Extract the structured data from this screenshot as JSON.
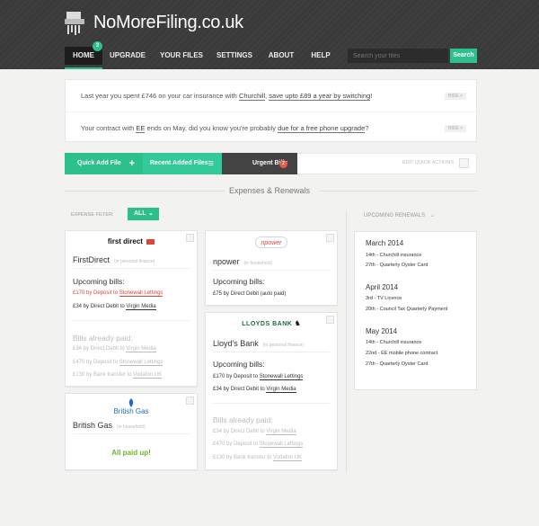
{
  "header": {
    "site_name": "NoMoreFiling.co.uk",
    "nav": [
      {
        "label": "HOME",
        "badge": "2"
      },
      {
        "label": "UPGRADE"
      },
      {
        "label": "YOUR FILES"
      },
      {
        "label": "SETTINGS"
      },
      {
        "label": "ABOUT"
      },
      {
        "label": "HELP"
      }
    ],
    "search_placeholder": "Search your files",
    "search_button": "Search"
  },
  "notices": [
    {
      "pre": "Last year you spent £746 on your car insurance with ",
      "link1": "Churchill",
      "mid": ", ",
      "link2": "save upto £89 a year by switching",
      "post": "!",
      "hide": "HIDE ×"
    },
    {
      "pre": "Your contract with ",
      "link1": "EE",
      "mid": " ends on May, did you know you're probably ",
      "link2": "due for a free phone upgrade",
      "post": "?",
      "hide": "HIDE ×"
    }
  ],
  "quick_actions": {
    "add_file": "Quick Add File",
    "recent": "Recent Added Files",
    "urgent": "Urgent Bills",
    "urgent_count": "2",
    "edit": "EDIT QUICK ACTIONS"
  },
  "section_title": "Expenses & Renewals",
  "filter": {
    "label": "EXPENSE FILTER:",
    "value": "ALL"
  },
  "cards": {
    "firstdirect": {
      "logo": "first direct",
      "name": "FirstDirect",
      "category": "(in personal finance)",
      "upcoming_title": "Upcoming bills:",
      "upcoming": [
        {
          "amount": "£170 by Deposit to ",
          "payee": "Stonewall Lettings"
        },
        {
          "amount": "£34 by Direct Debit to ",
          "payee": "Virgin Media"
        }
      ],
      "paid_title": "Bills already paid:",
      "paid": [
        {
          "amount": "£34 by Direct Debit to ",
          "payee": "Virgin Media"
        },
        {
          "amount": "£470 by Deposit to ",
          "payee": "Stonewall Lettings"
        },
        {
          "amount": "£130 by Bank transfer to ",
          "payee": "Vodafon UK"
        }
      ]
    },
    "npower": {
      "logo": "npower",
      "name": "npower",
      "category": "(in household)",
      "upcoming_title": "Upcoming bills:",
      "upcoming": [
        {
          "amount": "£75 by Direct Debit (auto paid)"
        }
      ]
    },
    "lloyds": {
      "logo": "LLOYDS BANK",
      "name": "Lloyd's Bank",
      "category": "(in personal finance)",
      "upcoming_title": "Upcoming bills:",
      "upcoming": [
        {
          "amount": "£170 by Deposit to ",
          "payee": "Stonewall Lettings"
        },
        {
          "amount": "£34 by Direct Debit to ",
          "payee": "Virgin Media"
        }
      ],
      "paid_title": "Bills already paid:",
      "paid": [
        {
          "amount": "£34 by Direct Debit to ",
          "payee": "Virgin Media"
        },
        {
          "amount": "£470 by Deposit to ",
          "payee": "Stonewall Lettings"
        },
        {
          "amount": "£130 by Bank transfer to ",
          "payee": "Vodafon UK"
        }
      ]
    },
    "britishgas": {
      "logo": "British Gas",
      "name": "British Gas",
      "category": "(in household)",
      "status": "All paid up!"
    }
  },
  "renewals": {
    "title": "UPCOMING RENEWALS",
    "months": [
      {
        "month": "March 2014",
        "items": [
          "14th - Churchill insurance",
          "27th - Quarterly Oyster Card"
        ]
      },
      {
        "month": "April 2014",
        "items": [
          "3rd - TV Licence",
          "20th - Council Tax Quarterly Payment"
        ]
      },
      {
        "month": "May 2014",
        "items": [
          "14th - Churchill insurance",
          "22nd - EE mobile phone contract",
          "27th - Quarterly Oyster Card"
        ]
      }
    ]
  },
  "colors": {
    "accent": "#2dbf8c",
    "dark": "#3a3a3a",
    "alert": "#e8584c",
    "paid": "#6ab42f"
  }
}
